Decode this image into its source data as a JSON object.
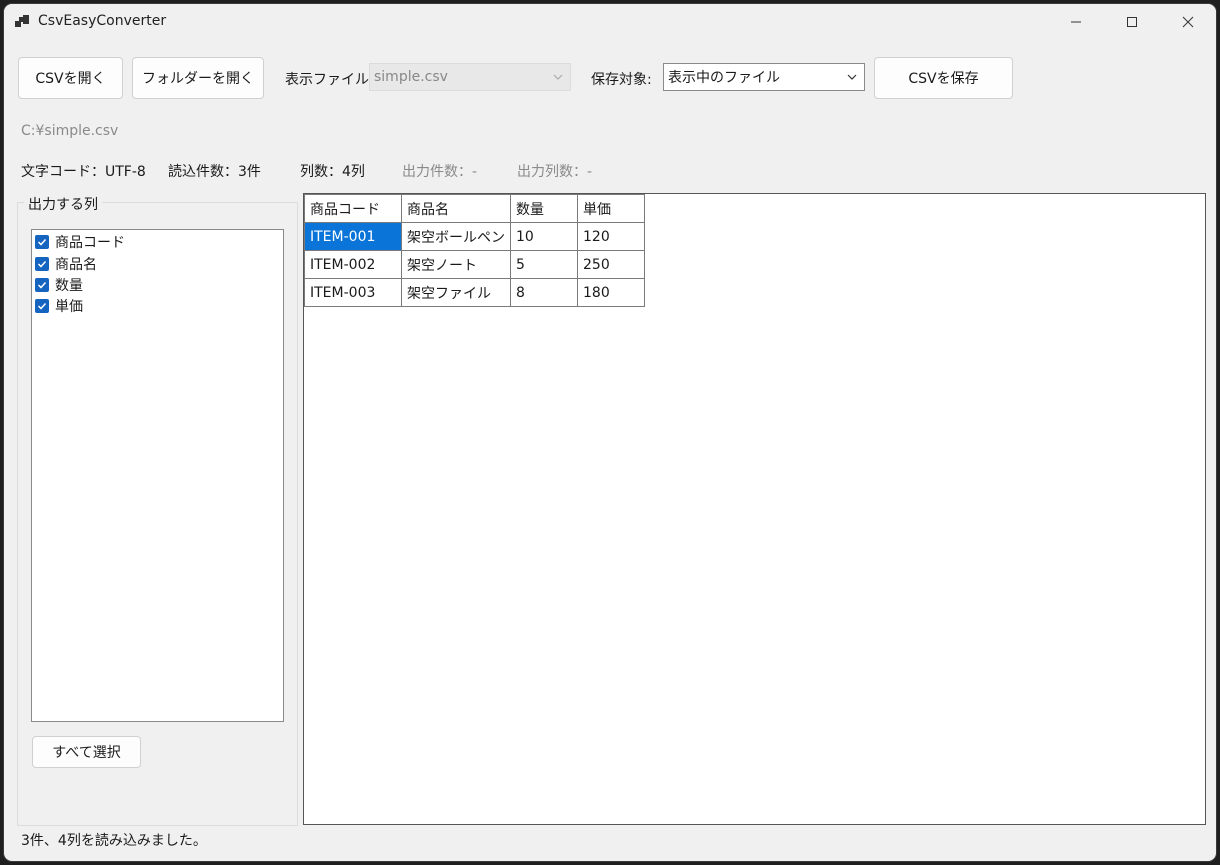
{
  "window": {
    "title": "CsvEasyConverter",
    "controls": {
      "minimize": "minimize-icon",
      "maximize": "maximize-icon",
      "close": "close-icon"
    }
  },
  "toolbar": {
    "open_csv_label": "CSVを開く",
    "open_folder_label": "フォルダーを開く",
    "display_file_label": "表示ファイル:",
    "display_file_value": "simple.csv",
    "save_target_label": "保存対象:",
    "save_target_value": "表示中のファイル",
    "save_csv_label": "CSVを保存"
  },
  "file_path": "C:¥simple.csv",
  "info": {
    "encoding": "文字コード：UTF-8",
    "read_count": "読込件数：3件",
    "column_count": "列数：4列",
    "output_count": "出力件数：-",
    "output_column_count": "出力列数：-"
  },
  "columns_panel": {
    "title": "出力する列",
    "items": [
      {
        "label": "商品コード",
        "checked": true
      },
      {
        "label": "商品名",
        "checked": true
      },
      {
        "label": "数量",
        "checked": true
      },
      {
        "label": "単価",
        "checked": true
      }
    ],
    "select_all_label": "すべて選択"
  },
  "grid": {
    "headers": [
      "商品コード",
      "商品名",
      "数量",
      "単価"
    ],
    "rows": [
      [
        "ITEM-001",
        "架空ボールペン",
        "10",
        "120"
      ],
      [
        "ITEM-002",
        "架空ノート",
        "5",
        "250"
      ],
      [
        "ITEM-003",
        "架空ファイル",
        "8",
        "180"
      ]
    ]
  },
  "status": "3件、4列を読み込みました。",
  "colors": {
    "accent": "#0a74d8",
    "checkbox": "#1565c0",
    "window_bg": "#f0f0f0"
  }
}
